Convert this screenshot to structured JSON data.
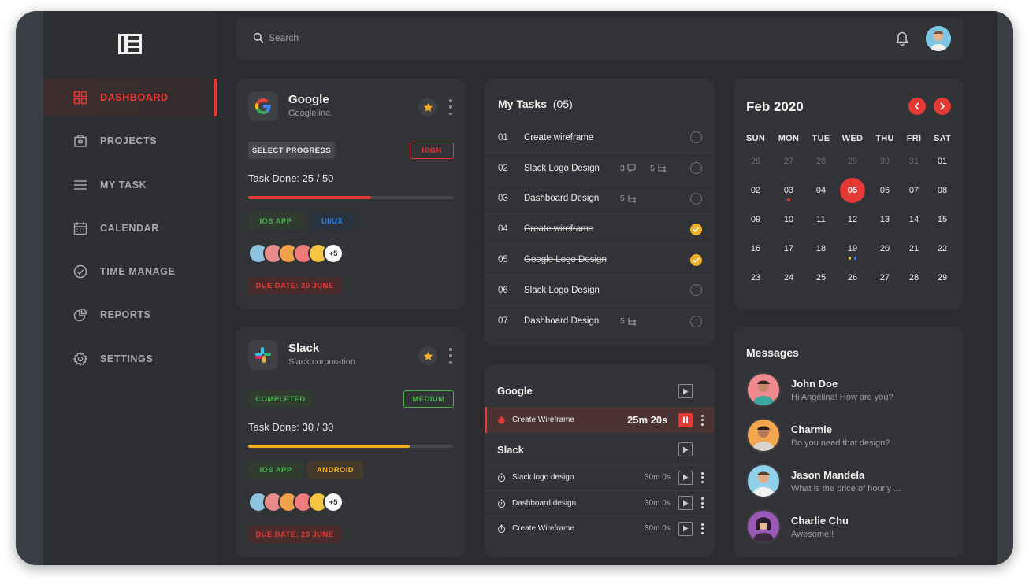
{
  "search": {
    "placeholder": "Search"
  },
  "sidebar": {
    "items": [
      {
        "label": "DASHBOARD",
        "icon": "dashboard-icon",
        "active": true
      },
      {
        "label": "PROJECTS",
        "icon": "briefcase-icon"
      },
      {
        "label": "MY TASK",
        "icon": "menu-icon"
      },
      {
        "label": "CALENDAR",
        "icon": "calendar-icon"
      },
      {
        "label": "TIME MANAGE",
        "icon": "clock-icon"
      },
      {
        "label": "REPORTS",
        "icon": "pie-chart-icon"
      },
      {
        "label": "SETTINGS",
        "icon": "gear-icon"
      }
    ]
  },
  "projects": [
    {
      "title": "Google",
      "subtitle": "Google inc.",
      "status": "SELECT PROGRESS",
      "priority": "HIGH",
      "task_done": "Task Done: 25 / 50",
      "progress": 0.6,
      "tags": [
        "IOS APP",
        "UI/UX"
      ],
      "more_members": "+5",
      "due": "DUE DATE: 20 JUNE"
    },
    {
      "title": "Slack",
      "subtitle": "Slack corporation",
      "status": "COMPLETED",
      "priority": "MEDIUM",
      "task_done": "Task Done: 30 / 30",
      "progress": 0.79,
      "tags": [
        "IOS APP",
        "ANDROID"
      ],
      "more_members": "+5",
      "due": "DUE DATE: 20 JUNE"
    }
  ],
  "tasks": {
    "title": "My Tasks",
    "count": "(05)",
    "items": [
      {
        "num": "01",
        "name": "Create wireframe",
        "comments": "",
        "subtasks": "",
        "done": false
      },
      {
        "num": "02",
        "name": "Slack Logo Design",
        "comments": "3",
        "subtasks": "5",
        "done": false
      },
      {
        "num": "03",
        "name": "Dashboard Design",
        "comments": "",
        "subtasks": "5",
        "done": false
      },
      {
        "num": "04",
        "name": "Create wireframe",
        "comments": "",
        "subtasks": "",
        "done": true
      },
      {
        "num": "05",
        "name": "Google Logo Design",
        "comments": "",
        "subtasks": "",
        "done": true
      },
      {
        "num": "06",
        "name": "Slack Logo Design",
        "comments": "",
        "subtasks": "",
        "done": false
      },
      {
        "num": "07",
        "name": "Dashboard Design",
        "comments": "",
        "subtasks": "5",
        "done": false
      }
    ]
  },
  "timer": {
    "groups": [
      {
        "name": "Google",
        "items": [
          {
            "name": "Create Wireframe",
            "time": "25m 20s",
            "active": true
          }
        ]
      },
      {
        "name": "Slack",
        "items": [
          {
            "name": "Slack logo design",
            "time": "30m 0s"
          },
          {
            "name": "Dashboard design",
            "time": "30m 0s"
          },
          {
            "name": "Create Wireframe",
            "time": "30m 0s"
          }
        ]
      }
    ]
  },
  "calendar": {
    "title": "Feb 2020",
    "weekdays": [
      "SUN",
      "MON",
      "TUE",
      "WED",
      "THU",
      "FRI",
      "SAT"
    ],
    "weeks": [
      [
        "26",
        "27",
        "28",
        "29",
        "30",
        "31",
        "01"
      ],
      [
        "02",
        "03",
        "04",
        "05",
        "06",
        "07",
        "08"
      ],
      [
        "09",
        "10",
        "11",
        "12",
        "13",
        "14",
        "15"
      ],
      [
        "16",
        "17",
        "18",
        "19",
        "20",
        "21",
        "22"
      ],
      [
        "23",
        "24",
        "25",
        "26",
        "27",
        "28",
        "29"
      ]
    ],
    "today": "05"
  },
  "messages": {
    "title": "Messages",
    "items": [
      {
        "name": "John Doe",
        "text": "Hi Angelina! How are you?"
      },
      {
        "name": "Charmie",
        "text": "Do you need that design?"
      },
      {
        "name": "Jason Mandela",
        "text": "What is the price of hourly ..."
      },
      {
        "name": "Charlie Chu",
        "text": "Awesome!!"
      }
    ]
  },
  "colors": {
    "accent": "#e53935",
    "star": "#f2b124",
    "progress_google": "#e53935",
    "progress_slack": "#f2b124"
  }
}
